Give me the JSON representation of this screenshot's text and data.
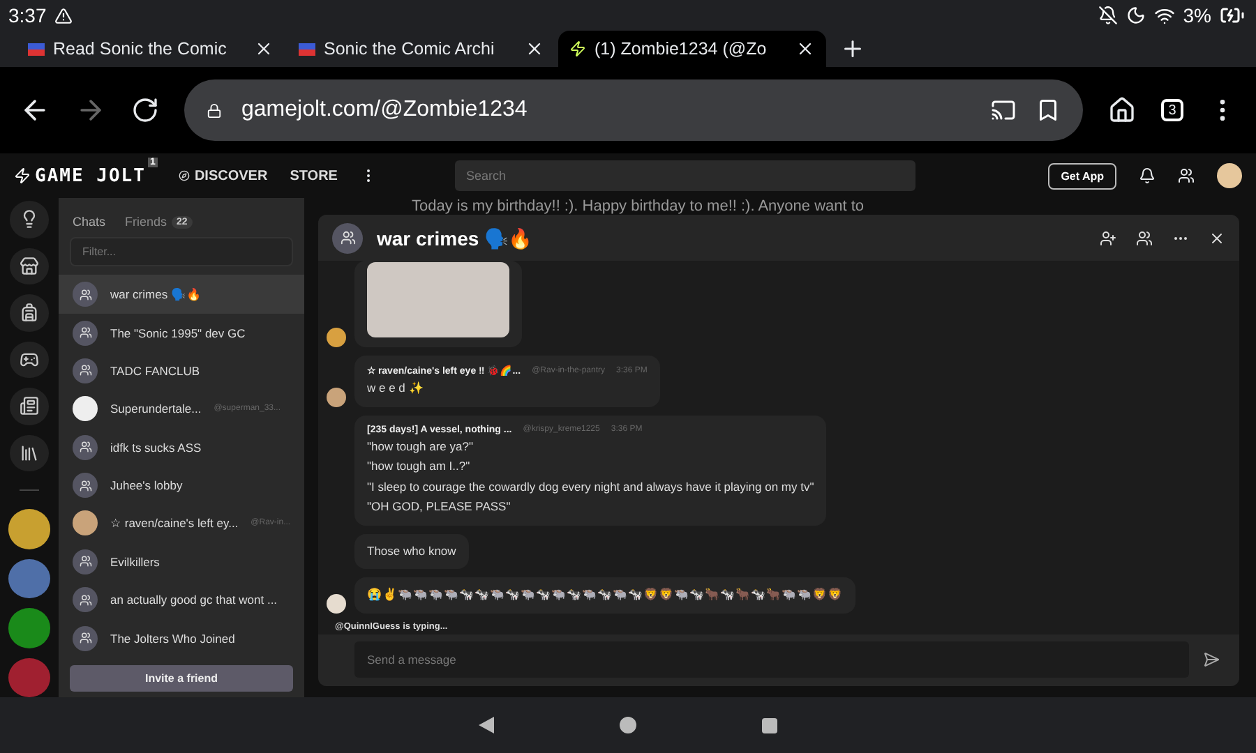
{
  "status_bar": {
    "time": "3:37",
    "battery": "3%"
  },
  "browser_tabs": [
    {
      "title": "Read Sonic the Comic",
      "selected": false
    },
    {
      "title": "Sonic the Comic Archi",
      "selected": false
    },
    {
      "title": "(1) Zombie1234 (@Zo",
      "selected": true
    }
  ],
  "address_bar": {
    "url": "gamejolt.com/@Zombie1234",
    "tab_count": "3"
  },
  "app_header": {
    "logo": "GAME JOLT",
    "logo_badge": "1",
    "nav": [
      "DISCOVER",
      "STORE"
    ],
    "search": {
      "placeholder": "Search"
    },
    "get_app": "Get App"
  },
  "background_text": "Today is my birthday!! :). Happy birthday to me!! :). Anyone want to",
  "chat_list": {
    "tabs": [
      {
        "label": "Chats",
        "selected": true
      },
      {
        "label": "Friends",
        "selected": false,
        "count": "22"
      }
    ],
    "filter": {
      "placeholder": "Filter..."
    },
    "items": [
      {
        "kind": "group",
        "name": "war crimes 🗣️🔥",
        "selected": true
      },
      {
        "kind": "group",
        "name": "The \"Sonic 1995\" dev GC",
        "selected": false
      },
      {
        "kind": "group",
        "name": "TADC FANCLUB",
        "selected": false
      },
      {
        "kind": "user",
        "name": "Superundertale...",
        "username": "@superman_33...",
        "selected": false
      },
      {
        "kind": "group",
        "name": "idfk ts sucks ASS",
        "selected": false
      },
      {
        "kind": "group",
        "name": "Juhee's lobby",
        "selected": false
      },
      {
        "kind": "user",
        "name": "☆ raven/caine's left ey...",
        "username": "@Rav-in...",
        "selected": false
      },
      {
        "kind": "group",
        "name": "Evilkillers",
        "selected": false
      },
      {
        "kind": "group",
        "name": "an actually good gc that wont ...",
        "selected": false
      },
      {
        "kind": "group",
        "name": "The Jolters Who Joined",
        "selected": false
      }
    ],
    "invite": "Invite a friend"
  },
  "chat_window": {
    "title": "war crimes 🗣️🔥",
    "messages": [
      {
        "kind": "image"
      },
      {
        "kind": "text",
        "author": "☆ raven/caine's left eye ‼ 🐞🌈...",
        "handle": "@Rav-in-the-pantry",
        "time": "3:36 PM",
        "lines": [
          "w e e d ✨"
        ]
      },
      {
        "kind": "text",
        "author": "[235 days!] A vessel, nothing ...",
        "handle": "@krispy_kreme1225",
        "time": "3:36 PM",
        "lines": [
          "\"how tough are ya?\"",
          "\"how tough am I..?\"",
          "\"I sleep to courage the cowardly dog every night and always have it playing on my tv\"",
          "\"OH GOD, PLEASE PASS\""
        ]
      },
      {
        "kind": "text",
        "lines": [
          "Those who know"
        ]
      },
      {
        "kind": "text",
        "lines": [
          "😭✌🐃🐃🐃🐃🐄🐄🐃🐄🐃🐄🐃🐄🐃🐄🐃🐄🦁🦁🐃🐄🐂🐄🐂🐄🐂🐃🐃🦁🦁"
        ]
      }
    ],
    "typing": "@QuinnIGuess is typing...",
    "input": {
      "placeholder": "Send a message"
    }
  }
}
